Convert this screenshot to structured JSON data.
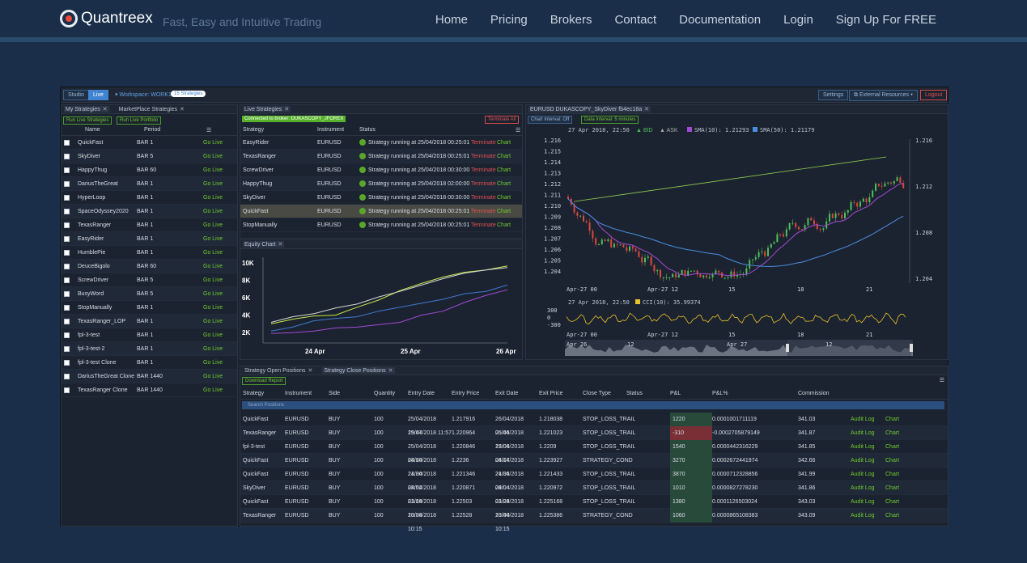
{
  "brand": {
    "name": "Quantreex",
    "tagline": "Fast, Easy and Intuitive Trading"
  },
  "nav": [
    "Home",
    "Pricing",
    "Brokers",
    "Contact",
    "Documentation",
    "Login",
    "Sign Up For FREE"
  ],
  "toolbar": {
    "studio": "Studio",
    "live": "Live",
    "workspace": "Workspace: WORK1",
    "strategies_badge": "15 Strategies",
    "settings": "Settings",
    "external": "External Resources",
    "logout": "Logout"
  },
  "left": {
    "tabs": [
      "My Strategies",
      "MarketPlace Strategies"
    ],
    "run_live": "Run Live Strategies",
    "run_portfolio": "Run Live Portfolio",
    "headers": [
      "Name",
      "Period"
    ],
    "go_live": "Go Live",
    "rows": [
      [
        "QuickFast",
        "BAR 1"
      ],
      [
        "SkyDiver",
        "BAR 5"
      ],
      [
        "HappyThug",
        "BAR 60"
      ],
      [
        "DariusTheGreat",
        "BAR 1"
      ],
      [
        "HyperLoop",
        "BAR 1"
      ],
      [
        "SpaceOdyssey2020",
        "BAR 1"
      ],
      [
        "TexasRanger",
        "BAR 1"
      ],
      [
        "EasyRider",
        "BAR 1"
      ],
      [
        "HumblePie",
        "BAR 1"
      ],
      [
        "DeuceBigolo",
        "BAR 60"
      ],
      [
        "ScrewDriver",
        "BAR 5"
      ],
      [
        "BusyWord",
        "BAR 5"
      ],
      [
        "StopManually",
        "BAR 1"
      ],
      [
        "TexasRanger_LOP",
        "BAR 1"
      ],
      [
        "fpl-3-test",
        "BAR 1"
      ],
      [
        "fpl-3-test-2",
        "BAR 1"
      ],
      [
        "fpl-3-test Clone",
        "BAR 1"
      ],
      [
        "DariusTheGreat Clone",
        "BAR 1440"
      ],
      [
        "TexasRanger Clone",
        "BAR 1440"
      ]
    ]
  },
  "live": {
    "tab": "Live Strategies",
    "connected": "Connected to broker: DUKASCOPY_JFOREX",
    "terminate_all": "Terminate All",
    "headers": [
      "Strategy",
      "Instrument",
      "Status"
    ],
    "terminate": "Terminate",
    "chart": "Chart",
    "rows": [
      [
        "EasyRider",
        "EURUSD",
        "Strategy running at 25/04/2018 00:25:01"
      ],
      [
        "TexasRanger",
        "EURUSD",
        "Strategy running at 25/04/2018 00:25:01"
      ],
      [
        "ScrewDriver",
        "EURUSD",
        "Strategy running at 25/04/2018 00:30:00"
      ],
      [
        "HappyThug",
        "EURUSD",
        "Strategy running at 25/04/2018 02:00:00"
      ],
      [
        "SkyDiver",
        "EURUSD",
        "Strategy running at 25/04/2018 00:30:00"
      ],
      [
        "QuickFast",
        "EURUSD",
        "Strategy running at 25/04/2018 00:25:01"
      ],
      [
        "StopManually",
        "EURUSD",
        "Strategy running at 25/04/2018 00:25:01"
      ]
    ]
  },
  "equity": {
    "tab": "Equity Chart",
    "yticks": [
      "10K",
      "8K",
      "6K",
      "4K",
      "2K"
    ],
    "xticks": [
      "24 Apr",
      "25 Apr",
      "26 Apr"
    ],
    "series": [
      {
        "color": "#c6e84a",
        "values": [
          2.4,
          3.0,
          3.4,
          3.5,
          4.5,
          5.4,
          6.6,
          7.5,
          8.3,
          8.9,
          9.2,
          9.7
        ]
      },
      {
        "color": "#d8d8d8",
        "values": [
          2.6,
          3.3,
          3.7,
          4.4,
          4.9,
          5.8,
          6.5,
          7.3,
          8.1,
          8.8,
          9.2,
          9.5
        ]
      },
      {
        "color": "#3f7ad1",
        "values": [
          1.5,
          2.0,
          2.8,
          3.1,
          3.3,
          4.0,
          4.5,
          5.0,
          5.5,
          6.2,
          6.5,
          7.3
        ]
      },
      {
        "color": "#a24ad6",
        "values": [
          1.2,
          1.3,
          1.5,
          1.9,
          2.0,
          2.3,
          2.6,
          3.5,
          4.0,
          5.1,
          6.0,
          6.7
        ]
      }
    ]
  },
  "price": {
    "tab": "EURUSD DUKASCOPY_SkyDiver fb4ec18a",
    "chart_interval": "Chart Interval: Off",
    "data_interval": "Data Interval: 5 minutes",
    "legend": "27 Apr 2018, 22:50",
    "bid": "BID",
    "ask": "ASK",
    "sma10": "SMA(10): 1.21293",
    "sma50": "SMA(50): 1.21179",
    "yleft": [
      "1.216",
      "1.215",
      "1.214",
      "1.213",
      "1.212",
      "1.211",
      "1.210",
      "1.209",
      "1.208",
      "1.207",
      "1.206",
      "1.205",
      "1.204"
    ],
    "yright": [
      "1.216",
      "1.212",
      "1.208",
      "1.204"
    ],
    "xticks": [
      "Apr-27 00",
      "Apr-27 12",
      "15",
      "18",
      "21"
    ],
    "cci_legend": "27 Apr 2018, 22:50",
    "cci": "CCI(10): 35.99374",
    "cci_ticks": [
      "300",
      "0",
      "-300"
    ],
    "nav_ticks": [
      "Apr 26",
      "12",
      "Apr 27",
      "12"
    ]
  },
  "bottom": {
    "tabs": [
      "Strategy Open Positions",
      "Strategy Close Positions"
    ],
    "download": "Download Report",
    "search": "Search Positions",
    "headers": [
      "Strategy",
      "Instrument",
      "Side",
      "Quantity",
      "Entry Date",
      "Entry Price",
      "Exit Date",
      "Exit Price",
      "Close Type",
      "Status",
      "P&L",
      "P&L%",
      "Commission"
    ],
    "audit": "Audit Log",
    "chart": "Chart",
    "rows": [
      [
        "QuickFast",
        "EURUSD",
        "BUY",
        "100",
        "25/04/2018 19:47",
        "1.217916",
        "26/04/2018 05:46",
        "1.218038",
        "STOP_LOSS_TRAIL",
        "",
        "1220",
        "0.0001001711119",
        "341.03"
      ],
      [
        "TexasRanger",
        "EURUSD",
        "BUY",
        "100",
        "25/04/2018 11:57",
        "1.220964",
        "25/04/2018 12:06",
        "1.221023",
        "STOP_LOSS_TRAIL",
        "",
        "-310",
        "-0.0002705879149",
        "341.87"
      ],
      [
        "fpl-3-test",
        "EURUSD",
        "BUY",
        "100",
        "25/04/2018 08:10",
        "1.220846",
        "25/04/2018 08:17",
        "1.2209",
        "STOP_LOSS_TRAIL",
        "",
        "1540",
        "0.0000442316229",
        "341.85"
      ],
      [
        "QuickFast",
        "EURUSD",
        "BUY",
        "100",
        "24/04/2018 21:30",
        "1.2236",
        "24/04/2018 21:35",
        "1.223927",
        "STRATEGY_COND",
        "",
        "3270",
        "0.0002672441974",
        "342.66"
      ],
      [
        "QuickFast",
        "EURUSD",
        "BUY",
        "100",
        "24/04/2018 08:52",
        "1.221346",
        "24/04/2018 09:04",
        "1.221433",
        "STOP_LOSS_TRAIL",
        "",
        "3870",
        "0.0000712328856",
        "341.99"
      ],
      [
        "SkyDiver",
        "EURUSD",
        "BUY",
        "100",
        "24/04/2018 01:19",
        "1.220871",
        "24/04/2018 01:29",
        "1.220972",
        "STOP_LOSS_TRAIL",
        "",
        "1010",
        "0.0000827278230",
        "341.86"
      ],
      [
        "QuickFast",
        "EURUSD",
        "BUY",
        "100",
        "23/04/2018 10:38",
        "1.22503",
        "23/04/2018 10:40",
        "1.225168",
        "STOP_LOSS_TRAIL",
        "",
        "1380",
        "0.0001126503024",
        "343.03"
      ],
      [
        "TexasRanger",
        "EURUSD",
        "BUY",
        "100",
        "23/04/2018 10:15",
        "1.22528",
        "23/04/2018 10:15",
        "1.225386",
        "STRATEGY_COND",
        "",
        "1060",
        "0.0000865108383",
        "343.09"
      ]
    ]
  }
}
